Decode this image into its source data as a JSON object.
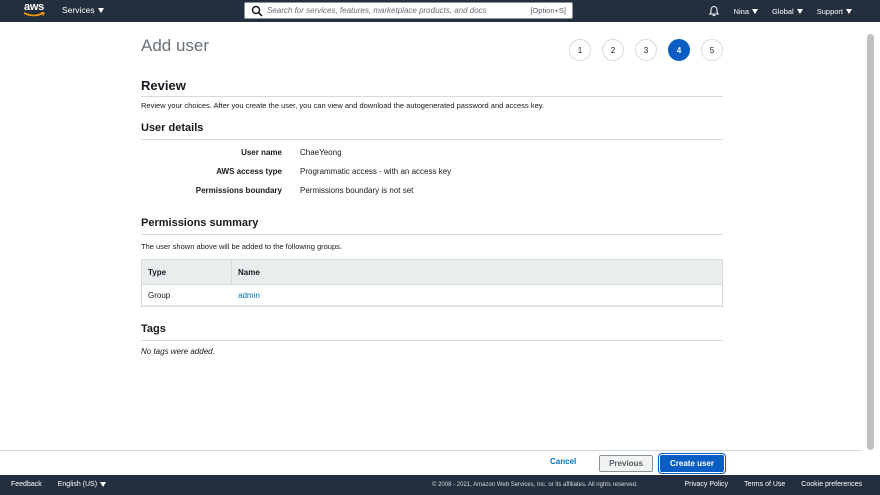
{
  "topnav": {
    "logo_text": "aws",
    "services_label": "Services",
    "search_placeholder": "Search for services, features, marketplace products, and docs",
    "search_shortcut": "[Option+S]",
    "user": "Nina",
    "region": "Global",
    "support": "Support"
  },
  "page": {
    "title": "Add user",
    "steps": [
      "1",
      "2",
      "3",
      "4",
      "5"
    ],
    "active_step": 4
  },
  "review": {
    "heading": "Review",
    "description": "Review your choices. After you create the user, you can view and download the autogenerated password and access key."
  },
  "user_details": {
    "heading": "User details",
    "rows": [
      {
        "label": "User name",
        "value": "ChaeYeong"
      },
      {
        "label": "AWS access type",
        "value": "Programmatic access - with an access key"
      },
      {
        "label": "Permissions boundary",
        "value": "Permissions boundary is not set"
      }
    ]
  },
  "permissions": {
    "heading": "Permissions summary",
    "description": "The user shown above will be added to the following groups.",
    "columns": [
      "Type",
      "Name"
    ],
    "rows": [
      {
        "type": "Group",
        "name": "admin"
      }
    ]
  },
  "tags": {
    "heading": "Tags",
    "empty_text": "No tags were added."
  },
  "actions": {
    "cancel": "Cancel",
    "previous": "Previous",
    "create": "Create user"
  },
  "footer": {
    "feedback": "Feedback",
    "language": "English (US)",
    "copyright": "© 2008 - 2021, Amazon Web Services, Inc. or its affiliates. All rights reserved.",
    "privacy": "Privacy Policy",
    "terms": "Terms of Use",
    "cookies": "Cookie preferences"
  },
  "colors": {
    "nav_bg": "#232f3e",
    "primary": "#0a5dc2",
    "link": "#0073bb",
    "smile": "#ff9900"
  }
}
